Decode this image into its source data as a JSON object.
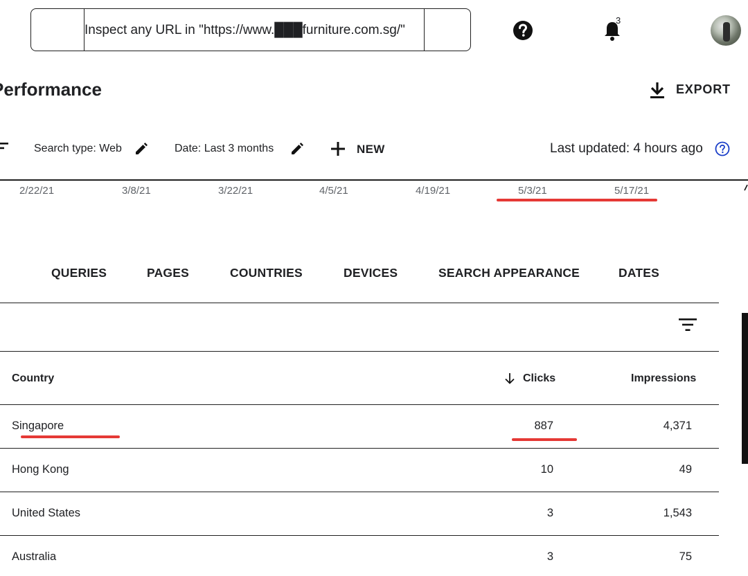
{
  "search": {
    "text": "Inspect any URL in \"https://www.███furniture.com.sg/\""
  },
  "header": {
    "notification_count": "3"
  },
  "page": {
    "title": "Performance",
    "export_label": "EXPORT"
  },
  "filters": {
    "search_type": "Search type: Web",
    "date": "Date: Last 3 months",
    "new_label": "NEW",
    "last_updated": "Last updated: 4 hours ago"
  },
  "axis_dates": [
    "2/22/21",
    "3/8/21",
    "3/22/21",
    "4/5/21",
    "4/19/21",
    "5/3/21",
    "5/17/21"
  ],
  "tabs": [
    "QUERIES",
    "PAGES",
    "COUNTRIES",
    "DEVICES",
    "SEARCH APPEARANCE",
    "DATES"
  ],
  "table": {
    "columns": {
      "country": "Country",
      "clicks": "Clicks",
      "impressions": "Impressions"
    },
    "rows": [
      {
        "country": "Singapore",
        "clicks": "887",
        "impressions": "4,371"
      },
      {
        "country": "Hong Kong",
        "clicks": "10",
        "impressions": "49"
      },
      {
        "country": "United States",
        "clicks": "3",
        "impressions": "1,543"
      },
      {
        "country": "Australia",
        "clicks": "3",
        "impressions": "75"
      }
    ]
  },
  "colors": {
    "highlight_red": "#e53935",
    "help_blue": "#1a3ec8"
  }
}
